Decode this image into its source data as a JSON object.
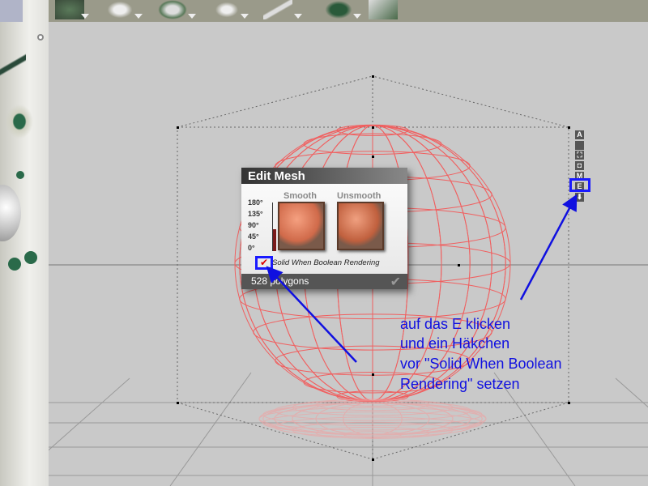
{
  "dialog": {
    "title": "Edit Mesh",
    "smooth_label": "Smooth",
    "unsmooth_label": "Unsmooth",
    "angles": [
      "180°",
      "135°",
      "90°",
      "45°",
      "0°"
    ],
    "smooth_angle_fraction": 0.45,
    "checkbox_label": "Solid When Boolean Rendering",
    "checkbox_checked": true,
    "polygon_count": "528 polygons"
  },
  "side_buttons": [
    "A",
    "■",
    "⛶",
    "◘",
    "M",
    "E",
    "⬇"
  ],
  "annotation": {
    "lines": [
      "auf das E klicken",
      "und ein Häkchen",
      "vor \"Solid When Boolean",
      "Rendering\" setzen"
    ]
  },
  "colors": {
    "annotation": "#1010e0",
    "wire": "#f06060"
  }
}
